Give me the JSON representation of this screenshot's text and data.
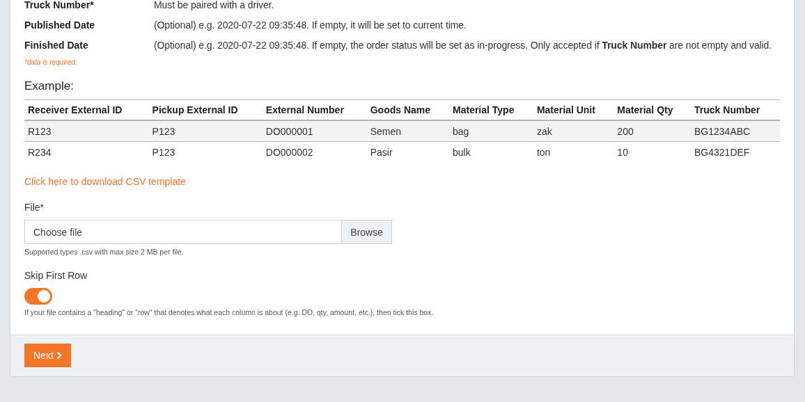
{
  "fields": [
    {
      "label": "Truck Number*",
      "description": "Must be paired with a driver."
    },
    {
      "label": "Published Date",
      "description": "(Optional) e.g. 2020-07-22 09:35:48. If empty, it will be set to current time."
    },
    {
      "label": "Finished Date",
      "description": "(Optional) e.g. 2020-07-22 09:35:48. If empty, the order status will be set as in-progress. Only accepted if **Truck Number** are not empty and valid."
    }
  ],
  "required_note": "*data is required.",
  "example": {
    "title": "Example:",
    "columns": [
      "Receiver External ID",
      "Pickup External ID",
      "External Number",
      "Goods Name",
      "Material Type",
      "Material Unit",
      "Material Qty",
      "Truck Number"
    ],
    "rows": [
      [
        "R123",
        "P123",
        "DO000001",
        "Semen",
        "bag",
        "zak",
        "200",
        "BG1234ABC"
      ],
      [
        "R234",
        "P123",
        "DO000002",
        "Pasir",
        "bulk",
        "ton",
        "10",
        "BG4321DEF"
      ]
    ]
  },
  "download_link": "Click here to download CSV template",
  "file": {
    "label": "File*",
    "placeholder": "Choose file",
    "button": "Browse",
    "help": "Supported types .csv with max size 2 MB per file."
  },
  "skip_first_row": {
    "label": "Skip First Row",
    "on": true,
    "help": "If your file contains a \"heading\" or \"row\" that denotes what each column is about (e.g. DO, qty, amount, etc.), then tick this box."
  },
  "next_button": "Next"
}
